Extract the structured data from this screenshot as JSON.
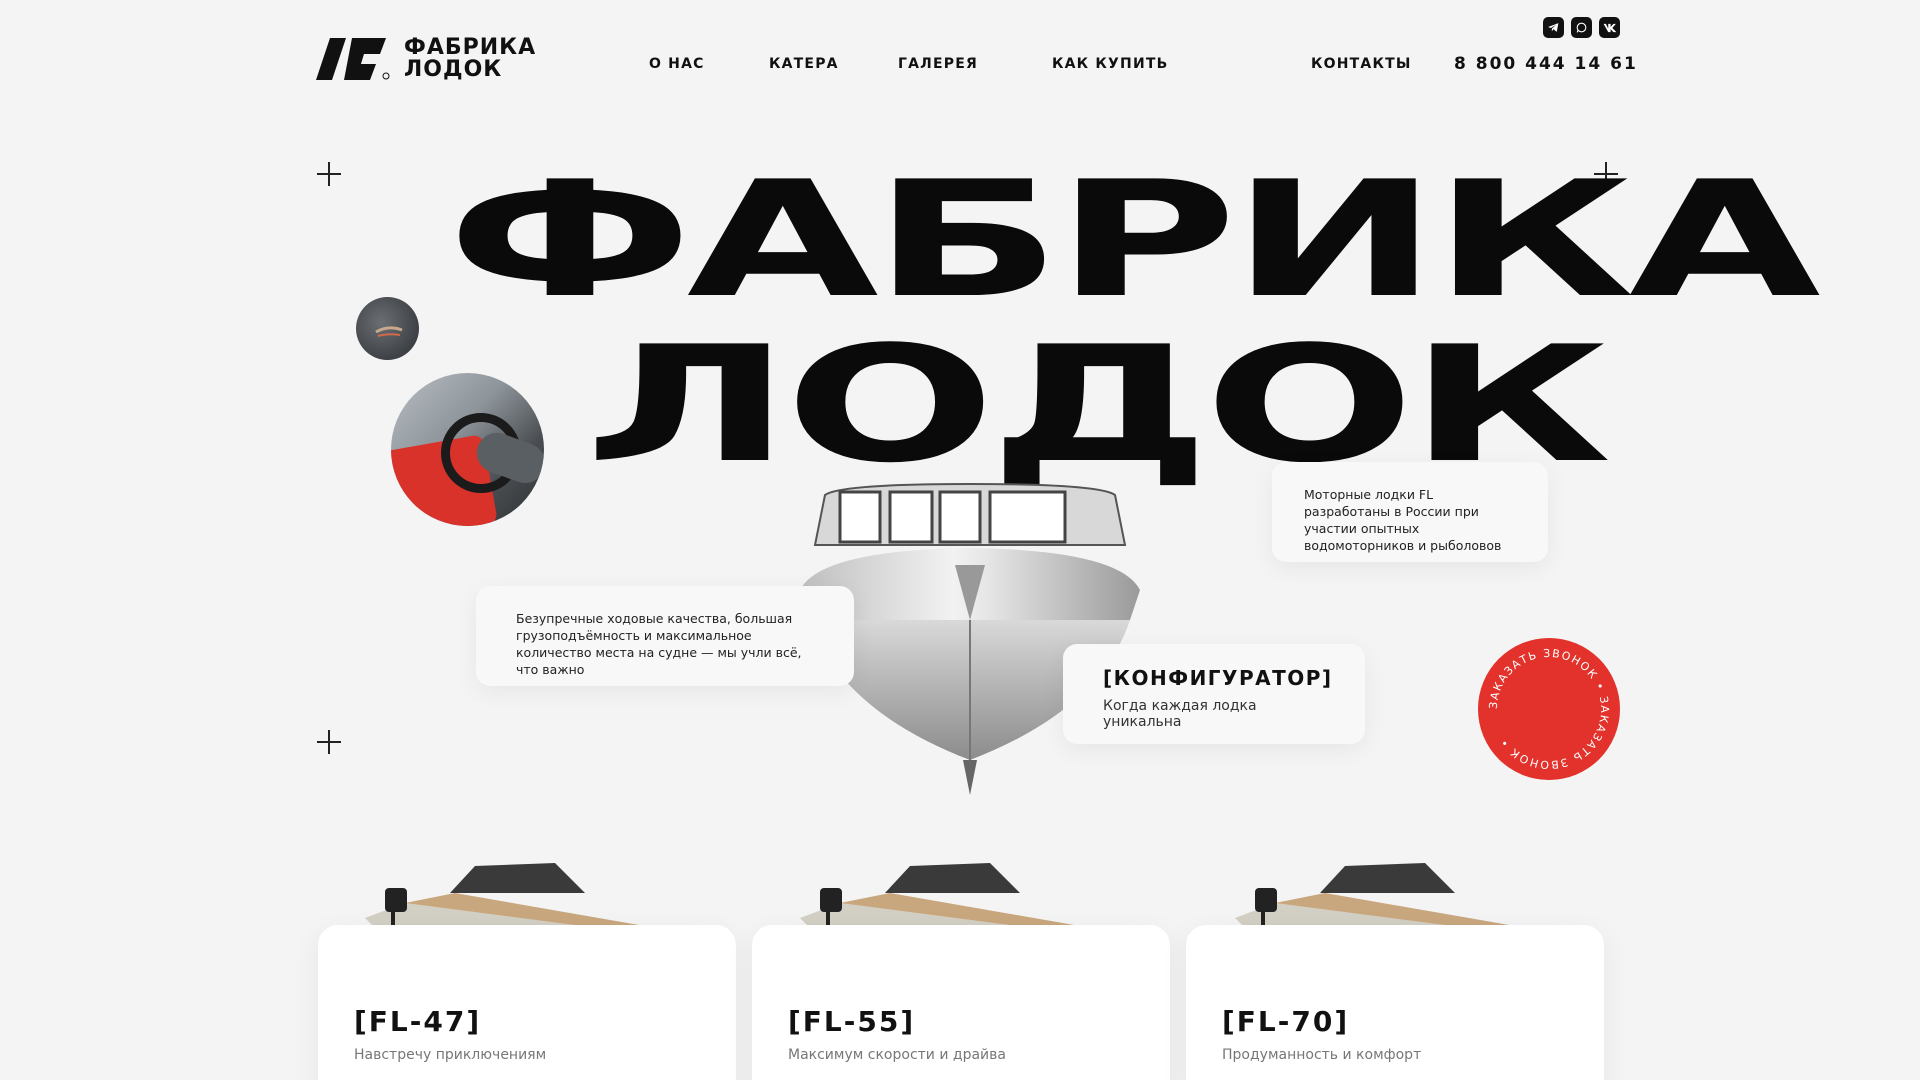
{
  "header": {
    "logo_text_line1": "ФАБРИКА",
    "logo_text_line2": "ЛОДОК",
    "nav": [
      "О НАС",
      "КАТЕРА",
      "ГАЛЕРЕЯ",
      "КАК КУПИТЬ",
      "КОНТАКТЫ"
    ],
    "phone": "8 800 444 14 61",
    "social_icons": [
      "telegram-icon",
      "whatsapp-icon",
      "vk-icon"
    ]
  },
  "hero": {
    "title_line1": "ФАБРИКА",
    "title_line2": "ЛОДОК",
    "note_right": "Моторные лодки FL разработаны в России при участии опытных водомоторников и рыболовов",
    "note_left": "Безупречные ходовые качества, большая грузоподъёмность и максимальное количество места на судне — мы учли всё, что важно",
    "configurator_title": "[КОНФИГУРАТОР]",
    "configurator_sub": "Когда каждая лодка уникальна",
    "call_text": "ЗАКАЗАТЬ ЗВОНОК • ЗАКАЗАТЬ ЗВОНОК • "
  },
  "products": [
    {
      "name": "[FL-47]",
      "desc": "Навстречу приключениям"
    },
    {
      "name": "[FL-55]",
      "desc": "Максимум скорости и драйва"
    },
    {
      "name": "[FL-70]",
      "desc": "Продуманность и комфорт"
    }
  ],
  "colors": {
    "accent": "#e2322b",
    "background": "#f4f4f4",
    "text": "#111111"
  }
}
